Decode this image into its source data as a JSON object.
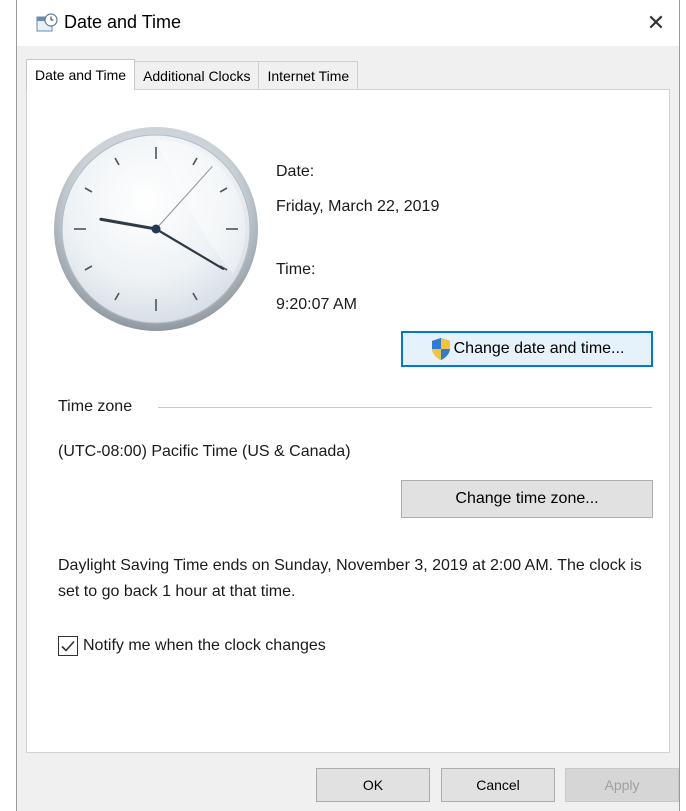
{
  "window": {
    "title": "Date and Time",
    "close_glyph": "✕"
  },
  "tabs": [
    {
      "label": "Date and Time",
      "active": true
    },
    {
      "label": "Additional Clocks",
      "active": false
    },
    {
      "label": "Internet Time",
      "active": false
    }
  ],
  "datetime": {
    "date_label": "Date:",
    "date_value": "Friday, March 22, 2019",
    "time_label": "Time:",
    "time_value": "9:20:07 AM",
    "change_button": "Change date and time..."
  },
  "clock": {
    "hour": 9,
    "minute": 20,
    "second": 7
  },
  "timezone": {
    "section_label": "Time zone",
    "value": "(UTC-08:00) Pacific Time (US & Canada)",
    "change_button": "Change time zone..."
  },
  "dst": {
    "message": "Daylight Saving Time ends on Sunday, November 3, 2019 at 2:00 AM. The clock is set to go back 1 hour at that time."
  },
  "notify": {
    "label": "Notify me when the clock changes",
    "checked": true
  },
  "footer": {
    "ok": "OK",
    "cancel": "Cancel",
    "apply": "Apply"
  },
  "colors": {
    "accent": "#0078d7",
    "dialog_bg": "#f0f0f0",
    "panel_bg": "#ffffff"
  },
  "icons": {
    "title": "date-time-icon",
    "close": "close-icon",
    "uac": "shield-icon",
    "check": "checkmark-icon"
  }
}
